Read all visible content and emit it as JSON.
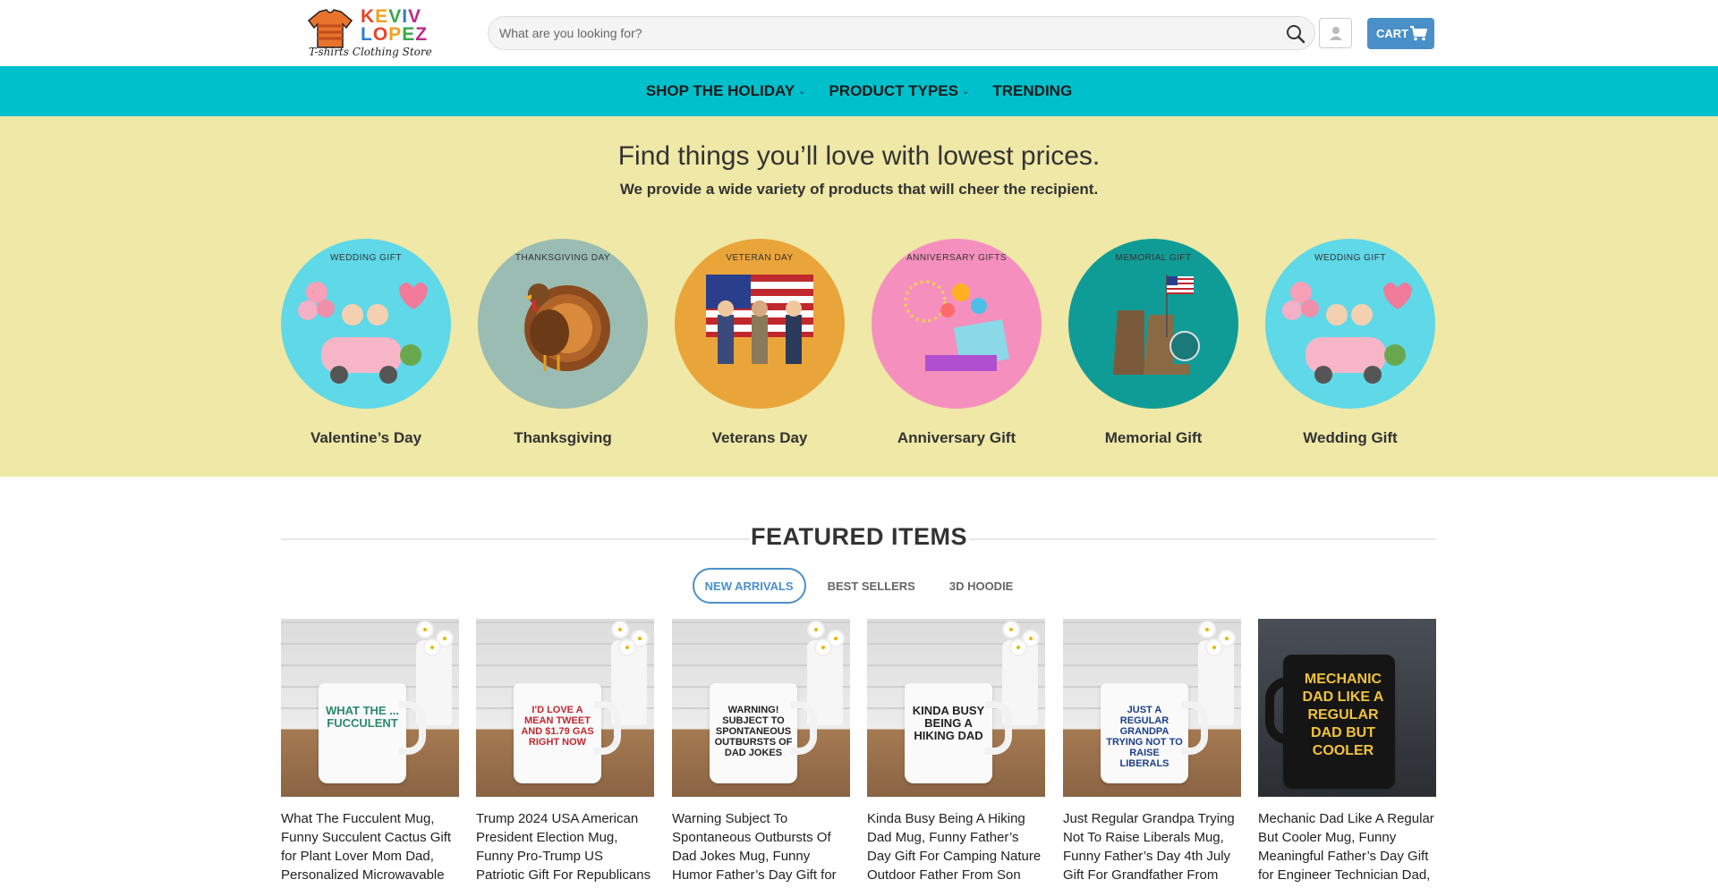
{
  "header": {
    "logo_line1": "KEVIV",
    "logo_line2": "LOPEZ",
    "logo_tagline": "T-shirts Clothing Store",
    "search_placeholder": "What are you looking for?",
    "cart_label": "CART"
  },
  "nav": {
    "items": [
      {
        "label": "SHOP THE HOLIDAY",
        "has_dropdown": true
      },
      {
        "label": "PRODUCT TYPES",
        "has_dropdown": true
      },
      {
        "label": "TRENDING",
        "has_dropdown": false
      }
    ]
  },
  "hero": {
    "title": "Find things you’ll love with lowest prices.",
    "subtitle": "We provide a wide variety of products that will cheer the recipient.",
    "categories": [
      {
        "label": "Valentine’s Day",
        "caption": "WEDDING GIFT",
        "color": "#5fd8e8"
      },
      {
        "label": "Thanksgiving",
        "caption": "THANKSGIVING DAY",
        "color": "#9bbcb2"
      },
      {
        "label": "Veterans Day",
        "caption": "VETERAN DAY",
        "color": "#eaa53a"
      },
      {
        "label": "Anniversary Gift",
        "caption": "ANNIVERSARY GIFTS",
        "color": "#f590be"
      },
      {
        "label": "Memorial Gift",
        "caption": "MEMORIAL GIFT",
        "color": "#109c96"
      },
      {
        "label": "Wedding Gift",
        "caption": "WEDDING GIFT",
        "color": "#5fd8e8"
      }
    ]
  },
  "featured": {
    "title": "FEATURED ITEMS",
    "tabs": [
      {
        "label": "NEW ARRIVALS",
        "active": true
      },
      {
        "label": "BEST SELLERS",
        "active": false
      },
      {
        "label": "3D HOODIE",
        "active": false
      }
    ],
    "products": [
      {
        "title": "What The Fucculent Mug, Funny Succulent Cactus Gift for Plant Lover Mom Dad, Personalized Microwavable",
        "mug_text": "WHAT THE ... FUCCULENT",
        "mug_color": "#2a8a6a"
      },
      {
        "title": "Trump 2024 USA American President Election Mug, Funny Pro-Trump US Patriotic Gift For Republicans",
        "mug_text": "I'D LOVE A MEAN TWEET AND $1.79 GAS RIGHT NOW",
        "mug_color": "#c0282e"
      },
      {
        "title": "Warning Subject To Spontaneous Outbursts Of Dad Jokes Mug, Funny Humor Father’s Day Gift for",
        "mug_text": "WARNING! SUBJECT TO SPONTANEOUS OUTBURSTS OF DAD JOKES",
        "mug_color": "#222222"
      },
      {
        "title": "Kinda Busy Being A Hiking Dad Mug, Funny Father’s Day Gift For Camping Nature Outdoor Father From Son",
        "mug_text": "KINDA BUSY BEING A HIKING DAD",
        "mug_color": "#222222"
      },
      {
        "title": "Just Regular Grandpa Trying Not To Raise Liberals Mug, Funny Father’s Day 4th July Gift For Grandfather From",
        "mug_text": "JUST A REGULAR GRANDPA TRYING NOT TO RAISE LIBERALS",
        "mug_color": "#1c3f8c"
      },
      {
        "title": "Mechanic Dad Like A Regular But Cooler Mug, Funny Meaningful Father’s Day Gift for Engineer Technician Dad,",
        "mug_text": "MECHANIC DAD LIKE A REGULAR DAD BUT COOLER",
        "mug_color": "#f2c23a"
      }
    ]
  },
  "colors": {
    "nav_bg": "#00c0cc",
    "hero_bg": "#efe8a6",
    "accent": "#4a90c8"
  }
}
